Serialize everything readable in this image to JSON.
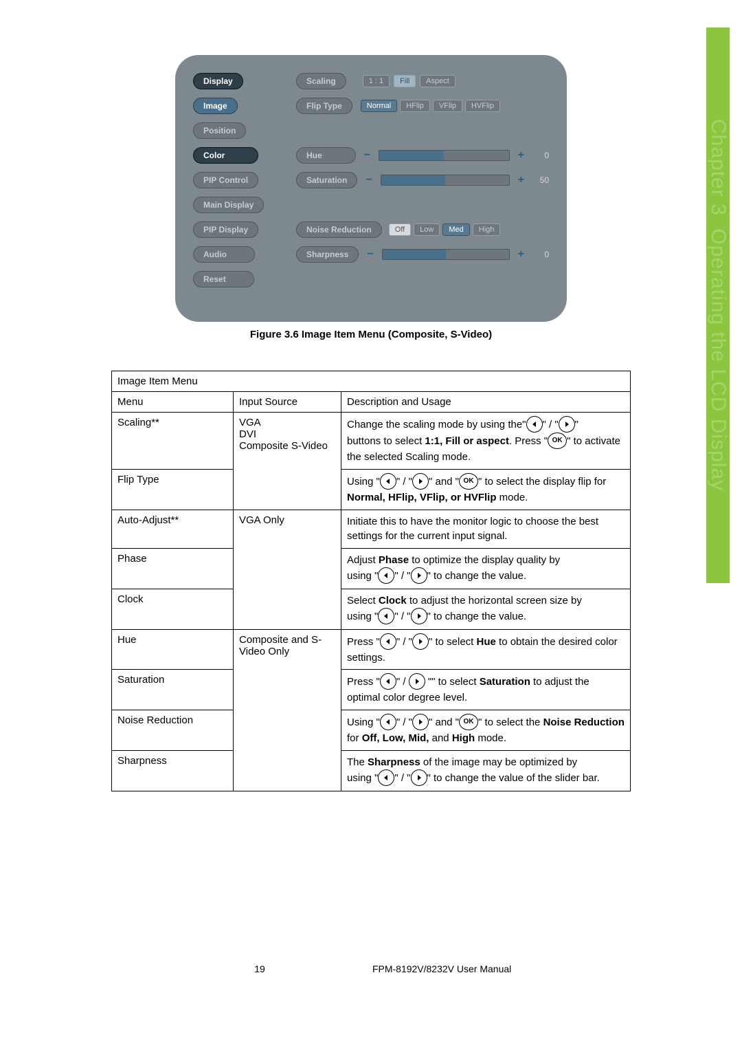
{
  "sidebar": {
    "chapter": "Chapter 3",
    "title": "Operating the LCD Display"
  },
  "osd": {
    "menu": {
      "display": "Display",
      "image": "Image",
      "position": "Position",
      "color": "Color",
      "pipControl": "PIP Control",
      "mainDisplay": "Main Display",
      "pipDisplay": "PIP Display",
      "audio": "Audio",
      "reset": "Reset"
    },
    "labels": {
      "scaling": "Scaling",
      "flipType": "Flip Type",
      "hue": "Hue",
      "saturation": "Saturation",
      "noiseReduction": "Noise Reduction",
      "sharpness": "Sharpness"
    },
    "scalingOpts": {
      "a": "1 : 1",
      "b": "Fill",
      "c": "Aspect"
    },
    "flipOpts": {
      "a": "Normal",
      "b": "HFlip",
      "c": "VFlip",
      "d": "HVFlip"
    },
    "nrOpts": {
      "a": "Off",
      "b": "Low",
      "c": "Med",
      "d": "High"
    },
    "values": {
      "hue": "0",
      "saturation": "50",
      "sharpness": "0"
    }
  },
  "figureCaption": "Figure 3.6 Image Item Menu (Composite, S-Video)",
  "table": {
    "title": "Image Item Menu",
    "headers": {
      "menu": "Menu",
      "input": "Input Source",
      "desc": "Description and Usage"
    },
    "rows": {
      "scaling": {
        "menu": "Scaling**",
        "input": "VGA\nDVI\nComposite S-Video",
        "d1": "Change the scaling mode by using the\"",
        "d2": "\" / \"",
        "d3": "\"",
        "d4": "buttons to select ",
        "d4b": "1:1, Fill or aspect",
        "d5": ". Press \"",
        "d6": "\" to activate the selected Scaling mode."
      },
      "flip": {
        "menu": "Flip Type",
        "d1": "Using \"",
        "d2": "\" / \"",
        "d3": "\" and \"",
        "d4": "\" to select the display flip for ",
        "d4b": "Normal, HFlip, VFlip, or HVFlip",
        "d5": " mode."
      },
      "auto": {
        "menu": "Auto-Adjust**",
        "input": "VGA Only",
        "d": "Initiate this to have the monitor logic to choose the best settings for the current input signal."
      },
      "phase": {
        "menu": "Phase",
        "d1": "Adjust ",
        "d1b": "Phase",
        "d1c": " to optimize the display quality by",
        "d2": "using \"",
        "d3": "\" / \"",
        "d4": "\" to change the value."
      },
      "clock": {
        "menu": "Clock",
        "d1": "Select ",
        "d1b": "Clock",
        "d1c": " to adjust the horizontal screen size by",
        "d2": "using \"",
        "d3": "\" / \"",
        "d4": "\" to change the value."
      },
      "hue": {
        "menu": "Hue",
        "input": "Composite and S-Video Only",
        "d1": "Press \"",
        "d2": "\" / \"",
        "d3": "\" to select ",
        "d3b": "Hue",
        "d4": " to obtain the desired color settings."
      },
      "sat": {
        "menu": "Saturation",
        "d1": "Press \"",
        "d2": "\" / ",
        "d3": " \"\" to select ",
        "d3b": "Saturation",
        "d4": " to adjust the optimal color degree level."
      },
      "nr": {
        "menu": "Noise Reduction",
        "d1": "Using \"",
        "d2": "\" / \"",
        "d3": "\" and \"",
        "d4": "\" to select the ",
        "d4b": "Noise Reduction",
        "d5": " for ",
        "d5b": "Off, Low, Mid,",
        "d5c": " and ",
        "d5d": "High",
        "d6": " mode."
      },
      "sharp": {
        "menu": "Sharpness",
        "d1": "The ",
        "d1b": "Sharpness",
        "d1c": " of the image may be optimized by",
        "d2": "using \"",
        "d3": "\" / \"",
        "d4": "\" to change the value of the slider bar."
      }
    }
  },
  "footer": {
    "page": "19",
    "manual": "FPM-8192V/8232V User Manual"
  }
}
